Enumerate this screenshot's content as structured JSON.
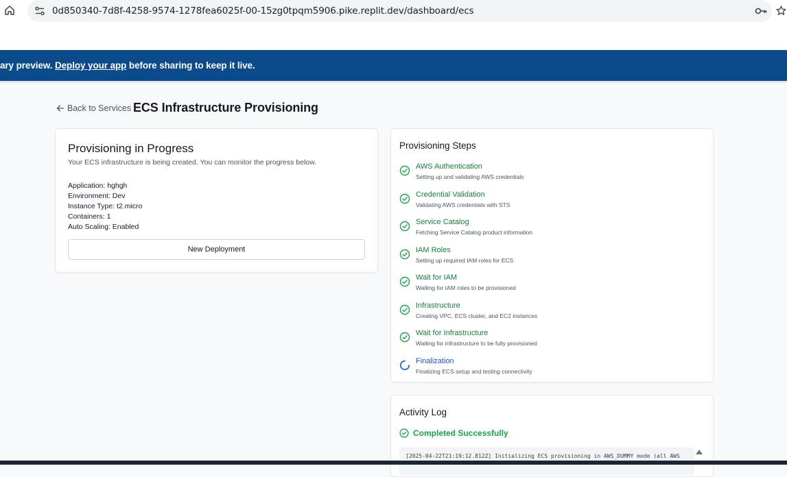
{
  "browser": {
    "url": "0d850340-7d8f-4258-9574-1278fea6025f-00-15zg0tpqm5906.pike.replit.dev/dashboard/ecs"
  },
  "banner": {
    "prefix": "ary preview. ",
    "link": "Deploy your app",
    "suffix": " before sharing to keep it live."
  },
  "header": {
    "back_label": "Back to Services",
    "title": "ECS Infrastructure Provisioning"
  },
  "status_card": {
    "title": "Provisioning in Progress",
    "subtitle": "Your ECS infrastructure is being created. You can monitor the progress below.",
    "details": [
      "Application: hghgh",
      "Environment: Dev",
      "Instance Type: t2.micro",
      "Containers: 1",
      "Auto Scaling: Enabled"
    ],
    "button_label": "New Deployment"
  },
  "steps_card": {
    "title": "Provisioning Steps",
    "steps": [
      {
        "name": "AWS Authentication",
        "desc": "Setting up and validating AWS credentials",
        "state": "done"
      },
      {
        "name": "Credential Validation",
        "desc": "Validating AWS credentials with STS",
        "state": "done"
      },
      {
        "name": "Service Catalog",
        "desc": "Fetching Service Catalog product information",
        "state": "done"
      },
      {
        "name": "IAM Roles",
        "desc": "Setting up required IAM roles for ECS",
        "state": "done"
      },
      {
        "name": "Wait for IAM",
        "desc": "Waiting for IAM roles to be provisioned",
        "state": "done"
      },
      {
        "name": "Infrastructure",
        "desc": "Creating VPC, ECS cluster, and EC2 instances",
        "state": "done"
      },
      {
        "name": "Wait for Infrastructure",
        "desc": "Waiting for infrastructure to be fully provisioned",
        "state": "done"
      },
      {
        "name": "Finalization",
        "desc": "Finalizing ECS setup and testing connectivity",
        "state": "active"
      }
    ]
  },
  "log_card": {
    "title": "Activity Log",
    "status": "Completed Successfully",
    "lines": [
      "[2025-04-22T21:19:12.812Z] Initializing ECS provisioning in AWS_DUMMY mode (all AWS"
    ]
  },
  "colors": {
    "banner": "#0b4a8b",
    "success": "#16a34a",
    "active": "#2563eb"
  }
}
